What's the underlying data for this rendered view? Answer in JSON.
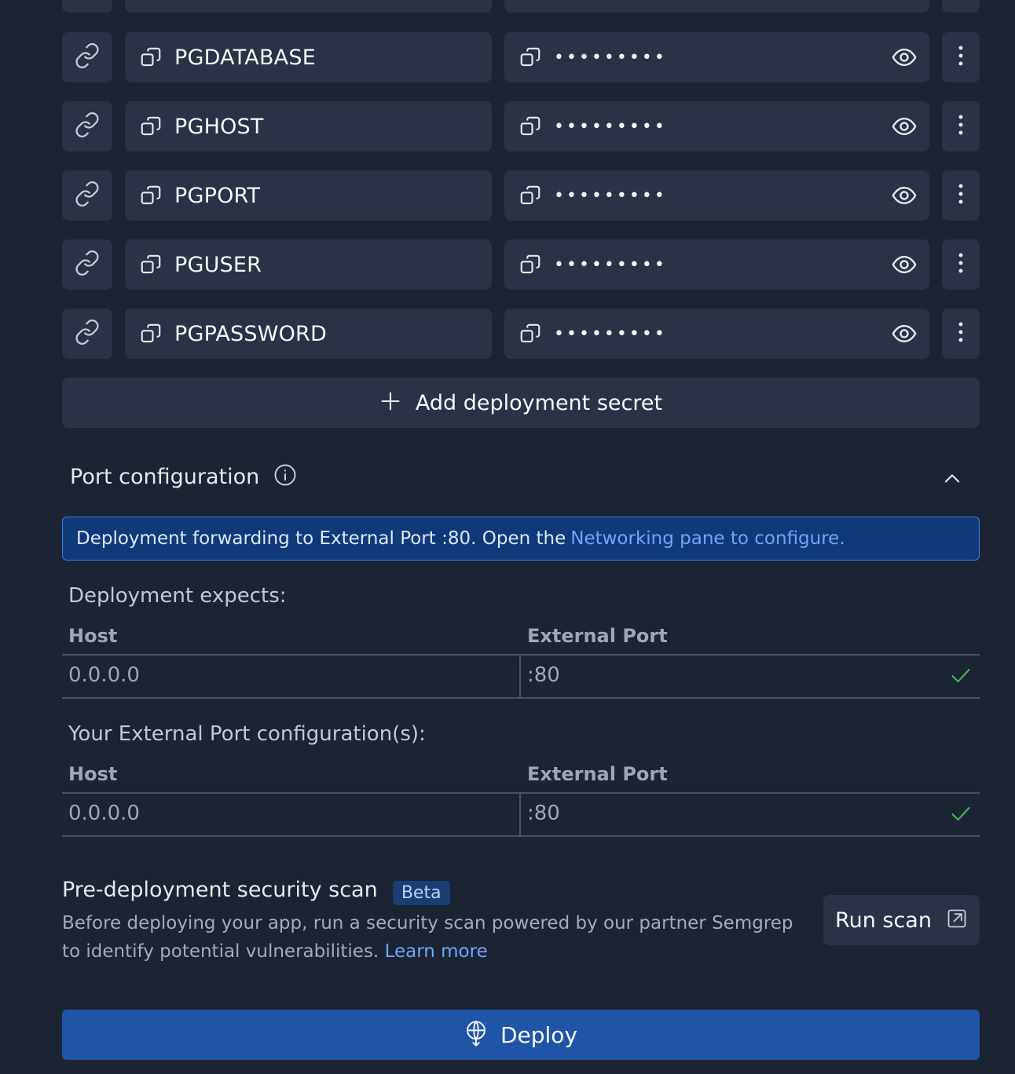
{
  "secrets": [
    {
      "key": "PGDATABASE",
      "value_masked": "•••••••••"
    },
    {
      "key": "PGHOST",
      "value_masked": "•••••••••"
    },
    {
      "key": "PGPORT",
      "value_masked": "•••••••••"
    },
    {
      "key": "PGUSER",
      "value_masked": "•••••••••"
    },
    {
      "key": "PGPASSWORD",
      "value_masked": "•••••••••"
    }
  ],
  "add_secret_label": "Add deployment secret",
  "port_config": {
    "title": "Port configuration",
    "banner_text": "Deployment forwarding to External Port :80. Open the",
    "banner_link": "Networking pane to configure.",
    "expects_heading": "Deployment expects:",
    "expects_table": {
      "headers": [
        "Host",
        "External Port"
      ],
      "row": {
        "host": "0.0.0.0",
        "port": ":80"
      }
    },
    "yours_heading": "Your External Port configuration(s):",
    "yours_table": {
      "headers": [
        "Host",
        "External Port"
      ],
      "row": {
        "host": "0.0.0.0",
        "port": ":80"
      }
    }
  },
  "security_scan": {
    "title": "Pre-deployment security scan",
    "badge": "Beta",
    "description": "Before deploying your app, run a security scan powered by our partner Semgrep to identify potential vulnerabilities.",
    "learn_more": "Learn more",
    "run_label": "Run scan"
  },
  "deploy_label": "Deploy",
  "colors": {
    "background": "#1c2333",
    "surface": "#2b3245",
    "accent": "#1f55a6",
    "link": "#6fa6f7",
    "success": "#3fb950"
  }
}
